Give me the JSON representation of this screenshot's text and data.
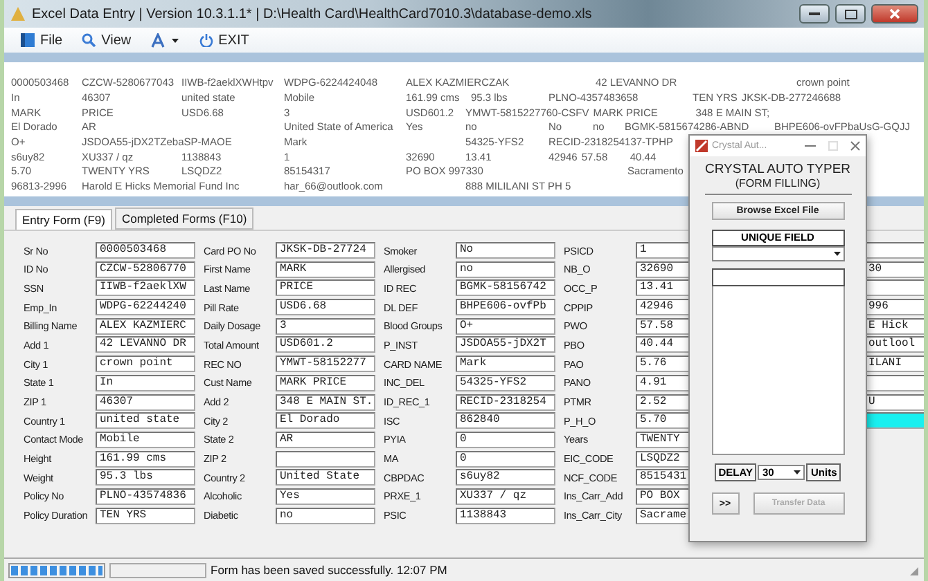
{
  "window": {
    "title": "Excel Data Entry | Version 10.3.1.1* | D:\\Health Card\\HealthCard7010.3\\database-demo.xls"
  },
  "menu": [
    {
      "kind": "file",
      "label": "File"
    },
    {
      "kind": "view",
      "label": "View"
    },
    {
      "kind": "font"
    },
    {
      "kind": "exit",
      "label": "EXIT"
    }
  ],
  "records": [
    [
      "0000503468",
      "CZCW-5280677043",
      "IIWB-f2aeklXWHtpv",
      "WDPG-6224424048",
      "ALEX KAZMIERCZAK",
      "42 LEVANNO DR",
      "crown point"
    ],
    [
      "In",
      "46307",
      "united state",
      "Mobile",
      "161.99 cms",
      "95.3 lbs",
      "PLNO-4357483658",
      "TEN YRS",
      "JKSK-DB-277246688"
    ],
    [
      "MARK",
      "PRICE",
      "USD6.68",
      "3",
      "USD601.2",
      "YMWT-5815227760-CSFV",
      "MARK PRICE",
      "348 E MAIN ST;"
    ],
    [
      "El Dorado",
      "AR",
      "United State of America",
      "Yes",
      "no",
      "No",
      "no",
      "BGMK-5815674286-ABND",
      "BHPE606-ovFPbaUsG-GQJJ"
    ],
    [
      "O+",
      "JSDOA55-jDX2TZebaSP-MAOE",
      "Mark",
      "54325-YFS2",
      "RECID-2318254137-TPHP"
    ],
    [
      "s6uy82",
      "XU337 / qz",
      "1138843",
      "1",
      "32690",
      "13.41",
      "42946",
      "57.58",
      "40.44"
    ],
    [
      "5.70",
      "TWENTY YRS",
      "LSQDZ2",
      "85154317",
      "PO BOX 997330",
      "Sacramento"
    ],
    [
      "96813-2996",
      "Harold E Hicks Memorial Fund Inc",
      "har_66@outlook.com",
      "888 MILILANI ST PH 5"
    ]
  ],
  "tabs": [
    {
      "label": "Entry Form (F9)",
      "selected": true
    },
    {
      "label": "Completed Forms (F10)",
      "selected": false
    }
  ],
  "form_columns": [
    {
      "fields": [
        {
          "label": "Sr No",
          "value": "0000503468"
        },
        {
          "label": "ID No",
          "value": "CZCW-52806770"
        },
        {
          "label": "SSN",
          "value": "IIWB-f2aeklXW"
        },
        {
          "label": "Emp_In",
          "value": "WDPG-62244240"
        },
        {
          "label": "Billing Name",
          "value": "ALEX KAZMIERC"
        },
        {
          "label": "Add 1",
          "value": "42 LEVANNO DR"
        },
        {
          "label": "City 1",
          "value": "crown point"
        },
        {
          "label": "State 1",
          "value": "In"
        },
        {
          "label": "ZIP 1",
          "value": "46307"
        },
        {
          "label": "Country 1",
          "value": "united state"
        },
        {
          "label": "Contact Mode",
          "value": "Mobile"
        },
        {
          "label": "Height",
          "value": "161.99 cms"
        },
        {
          "label": "Weight",
          "value": "95.3 lbs"
        },
        {
          "label": "Policy No",
          "value": "PLNO-43574836"
        },
        {
          "label": "Policy Duration",
          "value": "TEN YRS"
        }
      ]
    },
    {
      "fields": [
        {
          "label": "Card PO No",
          "value": "JKSK-DB-27724"
        },
        {
          "label": "First Name",
          "value": "MARK"
        },
        {
          "label": "Last Name",
          "value": "PRICE"
        },
        {
          "label": "Pill Rate",
          "value": "USD6.68"
        },
        {
          "label": "Daily Dosage",
          "value": "3"
        },
        {
          "label": "Total Amount",
          "value": "USD601.2"
        },
        {
          "label": "REC NO",
          "value": "YMWT-58152277"
        },
        {
          "label": "Cust Name",
          "value": "MARK PRICE"
        },
        {
          "label": "Add 2",
          "value": "348 E MAIN ST."
        },
        {
          "label": "City 2",
          "value": "El Dorado"
        },
        {
          "label": "State 2",
          "value": "AR"
        },
        {
          "label": "ZIP 2"
        },
        {
          "label": "Country 2",
          "value": "United State"
        },
        {
          "label": "Alcoholic",
          "value": "Yes"
        },
        {
          "label": "Diabetic",
          "value": "no"
        }
      ]
    },
    {
      "fields": [
        {
          "label": "Smoker",
          "value": "No"
        },
        {
          "label": "Allergised",
          "value": "no"
        },
        {
          "label": "ID REC",
          "value": "BGMK-58156742"
        },
        {
          "label": "DL DEF",
          "value": "BHPE606-ovfPb"
        },
        {
          "label": "Blood Groups",
          "value": "O+"
        },
        {
          "label": "P_INST",
          "value": "JSDOA55-jDX2T"
        },
        {
          "label": "CARD NAME",
          "value": "Mark"
        },
        {
          "label": "INC_DEL",
          "value": "54325-YFS2"
        },
        {
          "label": "ID_REC_1",
          "value": "RECID-2318254"
        },
        {
          "label": "ISC",
          "value": "862840"
        },
        {
          "label": "PYIA",
          "value": "0"
        },
        {
          "label": "MA",
          "value": "0"
        },
        {
          "label": "CBPDAC",
          "value": "s6uy82"
        },
        {
          "label": "PRXE_1",
          "value": "XU337 / qz"
        },
        {
          "label": "PSIC",
          "value": "1138843"
        }
      ]
    },
    {
      "fields": [
        {
          "label": "PSICD",
          "value": "1"
        },
        {
          "label": "NB_O",
          "value": "32690"
        },
        {
          "label": "OCC_P",
          "value": "13.41"
        },
        {
          "label": "CPPIP",
          "value": "42946"
        },
        {
          "label": "PWO",
          "value": "57.58"
        },
        {
          "label": "PBO",
          "value": "40.44"
        },
        {
          "label": "PAO",
          "value": "5.76"
        },
        {
          "label": "PANO",
          "value": "4.91"
        },
        {
          "label": "PTMR",
          "value": "2.52"
        },
        {
          "label": "P_H_O",
          "value": "5.70"
        },
        {
          "label": "Years",
          "value": "TWENTY"
        },
        {
          "label": "EIC_CODE",
          "value": "LSQDZ2"
        },
        {
          "label": "NCF_CODE",
          "value": "8515431"
        },
        {
          "label": "Ins_Carr_Add",
          "value": "PO BOX"
        },
        {
          "label": "Ins_Carr_City",
          "value": "Sacrame"
        }
      ]
    },
    {
      "fields": [
        {
          "highlighted": false
        },
        {
          "value": "30",
          "highlighted": false
        },
        {
          "highlighted": false
        },
        {
          "value": "996",
          "highlighted": false
        },
        {
          "value": "E Hick",
          "highlighted": false
        },
        {
          "value": "outlool",
          "highlighted": false
        },
        {
          "value": "ILANI",
          "highlighted": false
        },
        {
          "highlighted": false
        },
        {
          "value": "U",
          "highlighted": false
        },
        {
          "highlighted": true
        }
      ]
    }
  ],
  "status_bar": {
    "progress": {
      "level": 1
    },
    "message": "Form has been saved successfully. 12:07 PM"
  },
  "popup": {
    "title": "Crystal Aut...",
    "heading": "CRYSTAL AUTO TYPER",
    "subheading": "(FORM FILLING)",
    "browse_button": "Browse Excel File",
    "unique_field_label": "UNIQUE FIELD",
    "delay_label": "DELAY",
    "delay_value": "30",
    "units_label": "Units",
    "next_button": ">>",
    "transfer_button": {
      "label": "Transfer Data",
      "disabled": true
    }
  }
}
